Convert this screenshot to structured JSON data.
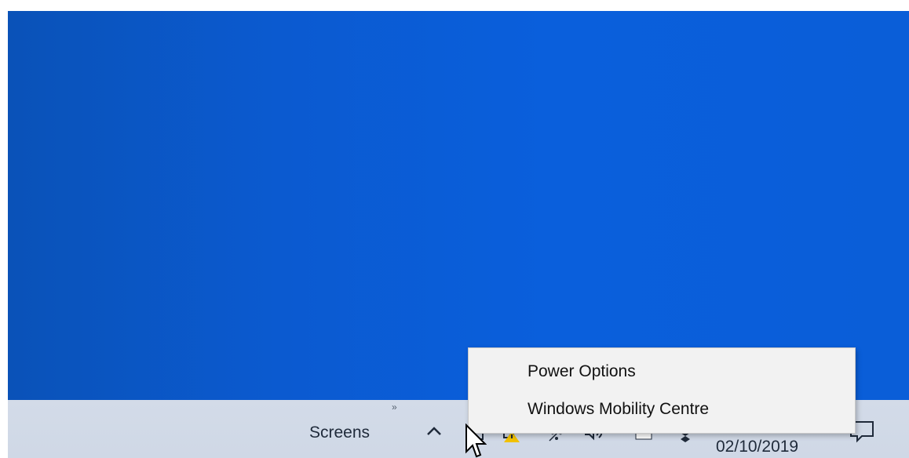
{
  "taskbar": {
    "toolbar_label": "Screens",
    "toolbar_overflow": "»",
    "tray_icons": [
      "chevron-up-icon",
      "usb-device-icon",
      "security-warning-icon",
      "wifi-icon",
      "volume-icon",
      "battery-icon",
      "dropbox-icon"
    ],
    "clock_date": "02/10/2019"
  },
  "context_menu": {
    "items": [
      {
        "label": "Power Options"
      },
      {
        "label": "Windows Mobility Centre"
      }
    ]
  },
  "colors": {
    "desktop_blue": "#0a5ed8",
    "taskbar": "#d3dbe8",
    "menu_bg": "#f2f2f2",
    "warning_yellow": "#f2c200"
  }
}
